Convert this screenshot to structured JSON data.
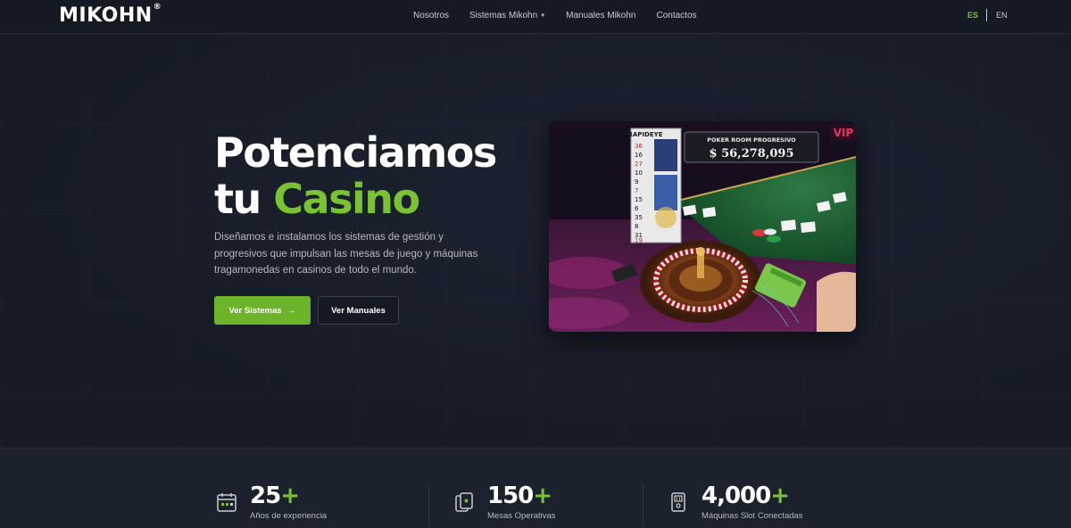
{
  "header": {
    "logo": "MIKOHN",
    "logo_mark": "®",
    "nav": [
      {
        "label": "Nosotros"
      },
      {
        "label": "Sistemas Mikohn",
        "has_dropdown": true
      },
      {
        "label": "Manuales Mikohn"
      },
      {
        "label": "Contactos"
      }
    ],
    "languages": {
      "active": "ES",
      "other": "EN",
      "active_color": "#79c232"
    }
  },
  "hero": {
    "title_line1": "Potenciamos",
    "title_line2_prefix": "tu",
    "title_line2_accent": "Casino",
    "description": "Diseñamos e instalamos los sistemas de gestión y progresivos que impulsan las mesas de juego y máquinas tragamonedas en casinos de todo el mundo.",
    "primary_button": "Ver Sistemas",
    "primary_button_icon": "arrow-right-icon",
    "secondary_button": "Ver Manuales",
    "image": {
      "jackpot_title": "POKER ROOM PROGRESIVO",
      "jackpot_amount": "$ 56,278,095",
      "brand_sign": "RAPIDEYE",
      "numbers": [
        "36",
        "16",
        "27",
        "10",
        "9",
        "7",
        "15",
        "6",
        "35",
        "8",
        "31",
        "19"
      ]
    }
  },
  "stats": [
    {
      "value": "25",
      "plus": "+",
      "label": "Años de experiencia",
      "icon": "calendar-icon"
    },
    {
      "value": "150",
      "plus": "+",
      "label": "Mesas Operativas",
      "icon": "cards-icon"
    },
    {
      "value": "4,000",
      "plus": "+",
      "label": "Máquinas Slot Conectadas",
      "icon": "slot-machine-icon"
    }
  ],
  "colors": {
    "accent": "#79c232",
    "button_primary": "#6cb52a",
    "background": "#161b26"
  }
}
